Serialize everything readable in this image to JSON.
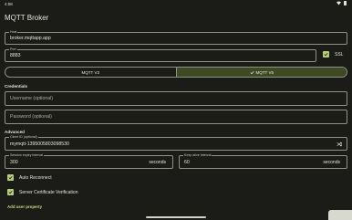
{
  "status": {
    "time": "4:08"
  },
  "title": "MQTT Broker",
  "host": {
    "label": "Host",
    "value": "broker.mqttapp.app"
  },
  "port": {
    "label": "Port",
    "value": "8883"
  },
  "ssl": {
    "label": "SSL",
    "checked": true
  },
  "protocol": {
    "options": [
      "MQTT V3",
      "MQTT V5"
    ],
    "selected": "MQTT V5"
  },
  "credentials": {
    "heading": "Credentials",
    "username_placeholder": "Username (optional)",
    "password_placeholder": "Password (optional)"
  },
  "advanced": {
    "heading": "Advanced",
    "client_id": {
      "label": "Client ID (optional)",
      "value": "mymqtt-1395005803098530"
    },
    "session_expiry": {
      "label": "Session expiry interval",
      "value": "300",
      "unit": "seconds"
    },
    "keep_alive": {
      "label": "Keep alive interval",
      "value": "60",
      "unit": "seconds"
    },
    "auto_reconnect": {
      "label": "Auto Reconnect",
      "checked": true
    },
    "server_cert": {
      "label": "Server Certificate Verification",
      "checked": true
    },
    "add_user_property": "Add user property"
  },
  "colors": {
    "accent": "#b9cd78",
    "selected_segment": "#3f4a24",
    "background": "#1b1c18"
  }
}
